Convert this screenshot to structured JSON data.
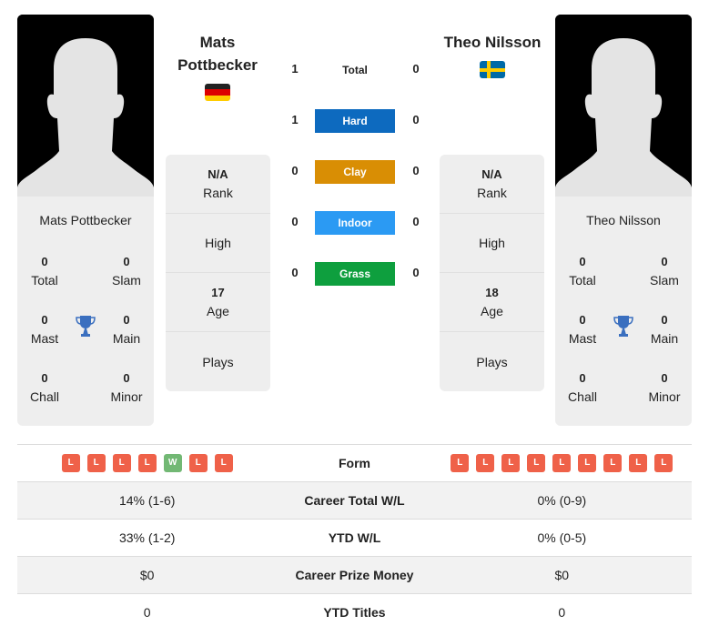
{
  "h2h": {
    "rows": [
      {
        "label": "Total",
        "left": "1",
        "right": "0",
        "color": "transparent"
      },
      {
        "label": "Hard",
        "left": "1",
        "right": "0",
        "color": "#0d6abf"
      },
      {
        "label": "Clay",
        "left": "0",
        "right": "0",
        "color": "#d98e04"
      },
      {
        "label": "Indoor",
        "left": "0",
        "right": "0",
        "color": "#2b9af3"
      },
      {
        "label": "Grass",
        "left": "0",
        "right": "0",
        "color": "#0e9f3e"
      }
    ]
  },
  "player1": {
    "name_line1": "Mats",
    "name_line2": "Pottbecker",
    "card_name": "Mats Pottbecker",
    "flag": "germany-flag",
    "rank_value": "N/A",
    "rank_label": "Rank",
    "high_label": "High",
    "age_value": "17",
    "age_label": "Age",
    "plays_label": "Plays",
    "titles": {
      "total": "0",
      "total_label": "Total",
      "slam": "0",
      "slam_label": "Slam",
      "mast": "0",
      "mast_label": "Mast",
      "main": "0",
      "main_label": "Main",
      "chall": "0",
      "chall_label": "Chall",
      "minor": "0",
      "minor_label": "Minor"
    },
    "form": [
      "L",
      "L",
      "L",
      "L",
      "W",
      "L",
      "L"
    ],
    "career_wl": "14% (1-6)",
    "ytd_wl": "33% (1-2)",
    "prize": "$0",
    "ytd_titles": "0"
  },
  "player2": {
    "name": "Theo Nilsson",
    "card_name": "Theo Nilsson",
    "flag": "sweden-flag",
    "rank_value": "N/A",
    "rank_label": "Rank",
    "high_label": "High",
    "age_value": "18",
    "age_label": "Age",
    "plays_label": "Plays",
    "titles": {
      "total": "0",
      "total_label": "Total",
      "slam": "0",
      "slam_label": "Slam",
      "mast": "0",
      "mast_label": "Mast",
      "main": "0",
      "main_label": "Main",
      "chall": "0",
      "chall_label": "Chall",
      "minor": "0",
      "minor_label": "Minor"
    },
    "form": [
      "L",
      "L",
      "L",
      "L",
      "L",
      "L",
      "L",
      "L",
      "L"
    ],
    "career_wl": "0% (0-9)",
    "ytd_wl": "0% (0-5)",
    "prize": "$0",
    "ytd_titles": "0"
  },
  "stats_labels": {
    "form": "Form",
    "career_wl": "Career Total W/L",
    "ytd_wl": "YTD W/L",
    "prize": "Career Prize Money",
    "ytd_titles": "YTD Titles"
  },
  "colors": {
    "loss": "#ef6149",
    "win": "#72b874",
    "trophy": "#3a6fbf"
  }
}
